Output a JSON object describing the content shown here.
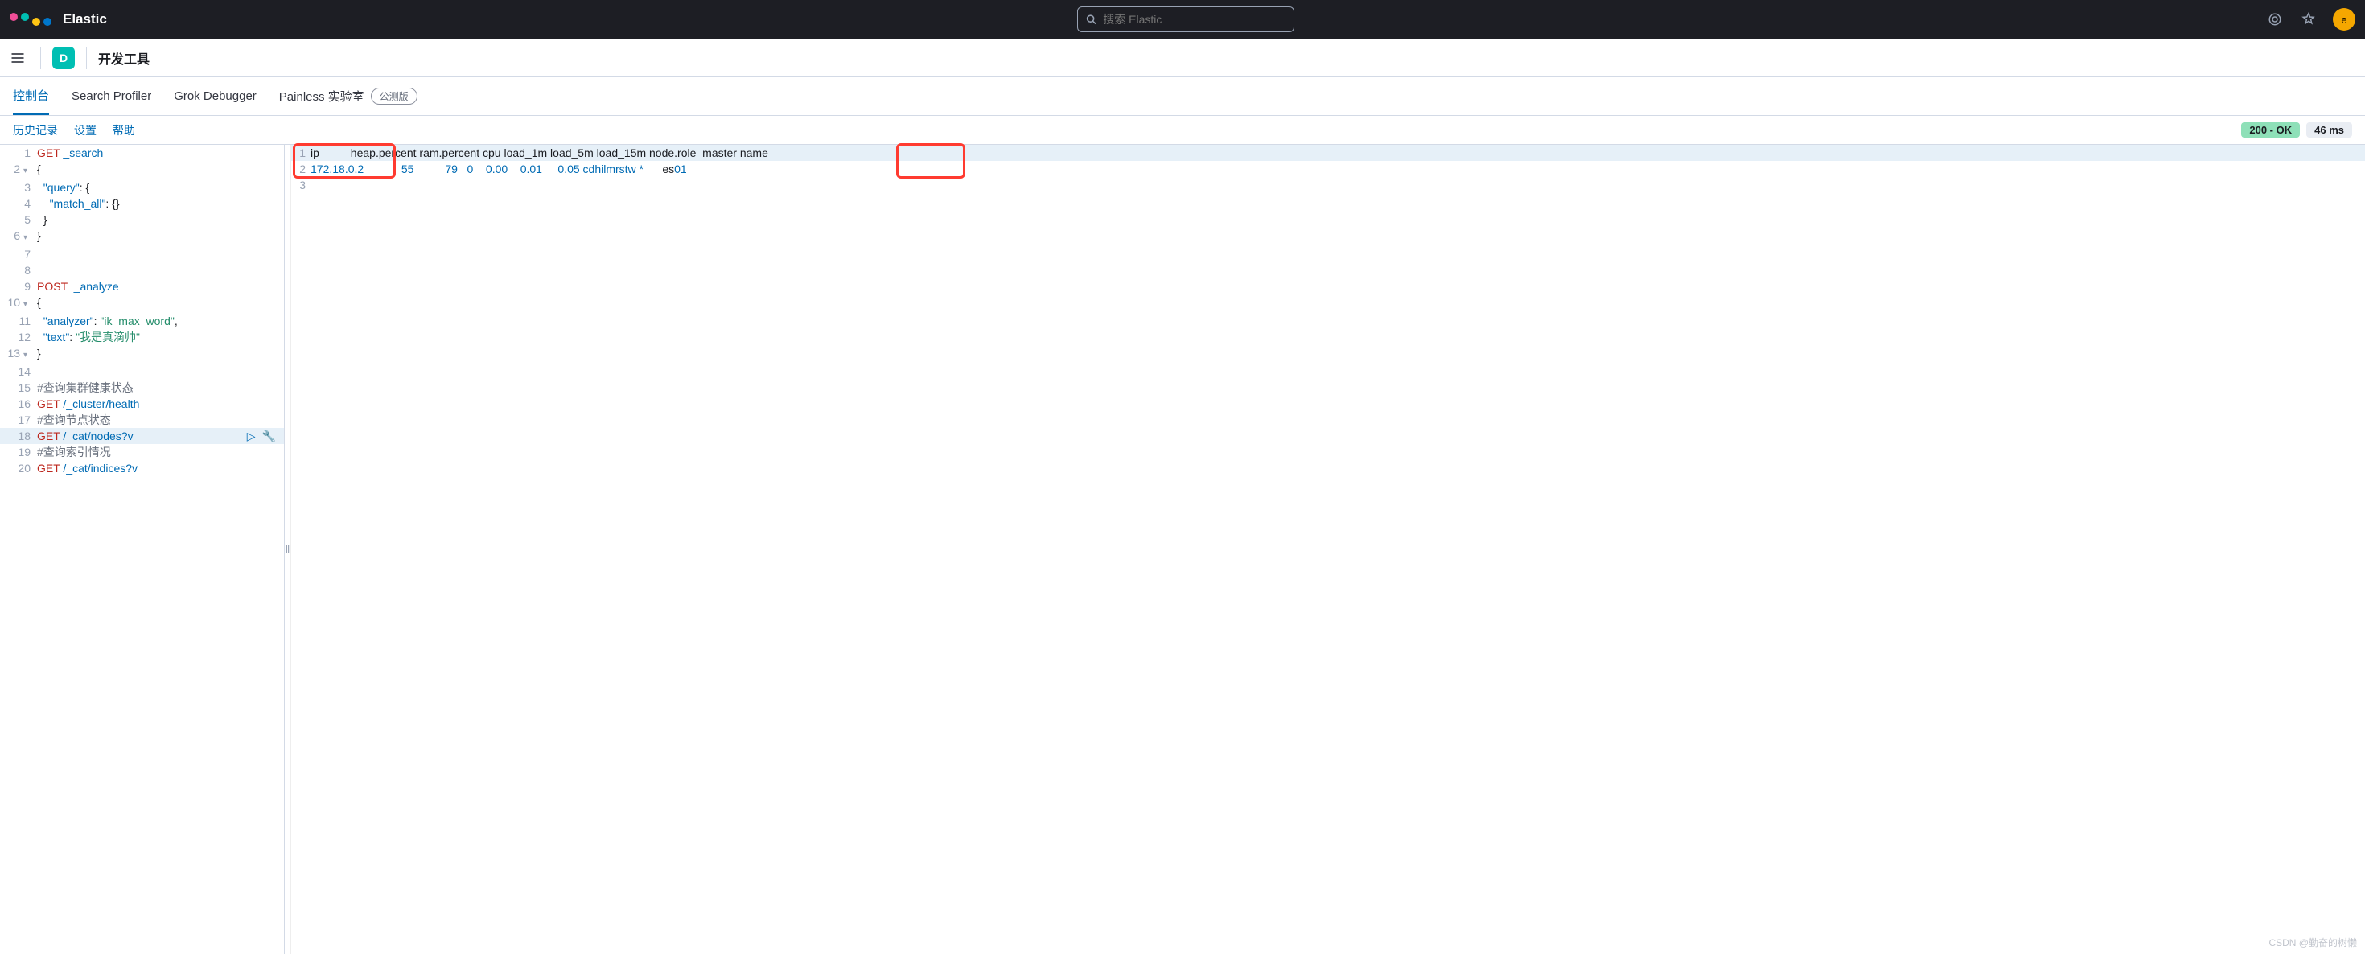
{
  "header": {
    "brand": "Elastic",
    "search_placeholder": "搜索 Elastic",
    "avatar_letter": "e"
  },
  "subheader": {
    "badge_letter": "D",
    "title": "开发工具"
  },
  "tabs": {
    "console": "控制台",
    "profiler": "Search Profiler",
    "grok": "Grok Debugger",
    "painless": "Painless 实验室",
    "beta": "公测版"
  },
  "toolbar": {
    "history": "历史记录",
    "settings": "设置",
    "help": "帮助",
    "status": "200 - OK",
    "timing": "46 ms"
  },
  "editor": {
    "lines": [
      {
        "n": "1",
        "kw": "GET",
        "path": "_search"
      },
      {
        "n": "2",
        "raw": "{",
        "fold": true
      },
      {
        "n": "3",
        "prop": "\"query\"",
        "post": ": {"
      },
      {
        "n": "4",
        "prop": "\"match_all\"",
        "post": ": {}",
        "indent": "    "
      },
      {
        "n": "5",
        "raw": "  }"
      },
      {
        "n": "6",
        "raw": "}",
        "fold": true
      },
      {
        "n": "7",
        "raw": ""
      },
      {
        "n": "8",
        "raw": ""
      },
      {
        "n": "9",
        "kw": "POST",
        "path": " _analyze"
      },
      {
        "n": "10",
        "raw": "{",
        "fold": true
      },
      {
        "n": "11",
        "prop": "\"analyzer\"",
        "str": "\"ik_max_word\"",
        "trail": ","
      },
      {
        "n": "12",
        "prop": "\"text\"",
        "str": "\"我是真滴帅\""
      },
      {
        "n": "13",
        "raw": "}",
        "fold": true
      },
      {
        "n": "14",
        "raw": ""
      },
      {
        "n": "15",
        "comment": "#查询集群健康状态"
      },
      {
        "n": "16",
        "kw": "GET",
        "path": "/_cluster/health"
      },
      {
        "n": "17",
        "comment": "#查询节点状态"
      },
      {
        "n": "18",
        "kw": "GET",
        "path": "/_cat/nodes?v",
        "active": true
      },
      {
        "n": "19",
        "comment": "#查询索引情况"
      },
      {
        "n": "20",
        "kw": "GET",
        "path": "/_cat/indices?v"
      }
    ]
  },
  "response": {
    "header_line": "ip          heap.percent ram.percent cpu load_1m load_5m load_15m node.role  master name",
    "data_line_pre": "172.18.0.2            55          79   0    0.00    0.01     0.05 cdhilmrstw *      ",
    "data_name_prefix": "es",
    "data_name_suffix": "01"
  },
  "watermark": "CSDN @勤奋的树懒"
}
